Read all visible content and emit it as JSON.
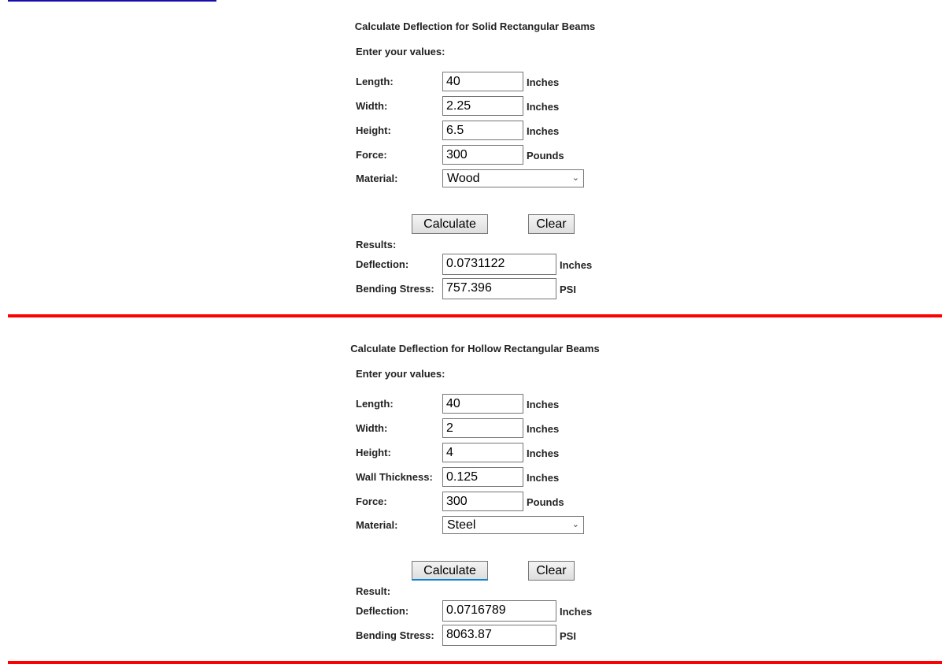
{
  "solid": {
    "title": "Calculate Deflection for Solid Rectangular Beams",
    "enter_label": "Enter your values:",
    "fields": [
      {
        "label": "Length:",
        "value": "40",
        "unit": "Inches"
      },
      {
        "label": "Width:",
        "value": "2.25",
        "unit": "Inches"
      },
      {
        "label": "Height:",
        "value": "6.5",
        "unit": "Inches"
      },
      {
        "label": "Force:",
        "value": "300",
        "unit": "Pounds"
      }
    ],
    "material_label": "Material:",
    "material_value": "Wood",
    "calculate_label": "Calculate",
    "clear_label": "Clear",
    "results_label": "Results:",
    "results": [
      {
        "label": "Deflection:",
        "value": "0.0731122",
        "unit": "Inches"
      },
      {
        "label": "Bending Stress:",
        "value": "757.396",
        "unit": "PSI"
      }
    ]
  },
  "hollow": {
    "title": "Calculate Deflection for Hollow Rectangular Beams",
    "enter_label": "Enter your values:",
    "fields": [
      {
        "label": "Length:",
        "value": "40",
        "unit": "Inches"
      },
      {
        "label": "Width:",
        "value": "2",
        "unit": "Inches"
      },
      {
        "label": "Height:",
        "value": "4",
        "unit": "Inches"
      },
      {
        "label": "Wall Thickness:",
        "value": "0.125",
        "unit": "Inches"
      },
      {
        "label": "Force:",
        "value": "300",
        "unit": "Pounds"
      }
    ],
    "material_label": "Material:",
    "material_value": "Steel",
    "calculate_label": "Calculate",
    "clear_label": "Clear",
    "results_label": "Result:",
    "results": [
      {
        "label": "Deflection:",
        "value": "0.0716789",
        "unit": "Inches"
      },
      {
        "label": "Bending Stress:",
        "value": "8063.87",
        "unit": "PSI"
      }
    ]
  },
  "colors": {
    "divider": "#ff0000",
    "link": "#1a0dab"
  }
}
